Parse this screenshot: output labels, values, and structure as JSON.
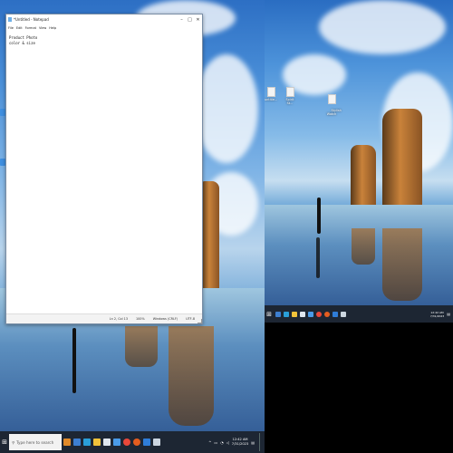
{
  "notepad": {
    "title": "*Untitled - Notepad",
    "menu": [
      "File",
      "Edit",
      "Format",
      "View",
      "Help"
    ],
    "content": "Product Photo\ncolor & size",
    "status": {
      "position": "Ln 2, Col 13",
      "zoom": "100%",
      "line_ending": "Windows (CRLF)",
      "encoding": "UTF-8"
    }
  },
  "taskbar": {
    "search_placeholder": "Type here to search",
    "time": "12:42 AM",
    "date": "7/31/2023",
    "right_time": "12:42 AM",
    "right_date": "7/31/2023"
  },
  "desktop_right": {
    "icons": [
      {
        "label": "untitle..."
      },
      {
        "label": "Spirit St..."
      },
      {
        "label": "Stylish\nWatch"
      }
    ]
  },
  "colors": {
    "taskbar": "#1d2633",
    "notepad_border": "#7a8ea6",
    "sky_top": "#2d6fc4"
  },
  "icons": {
    "start": "windows-start-icon",
    "search": "search-icon",
    "minimize": "minimize-icon",
    "maximize": "maximize-icon",
    "close": "close-icon"
  }
}
